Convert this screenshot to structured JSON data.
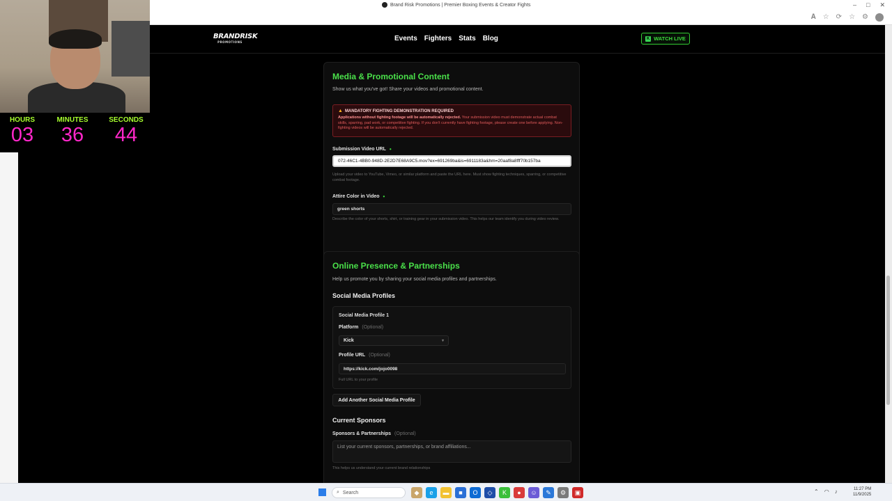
{
  "browser": {
    "tab_title": "Brand Risk Promotions | Premier Boxing Events & Creator Fights",
    "window_controls": [
      "–",
      "□",
      "✕"
    ]
  },
  "site": {
    "logo_text": "BRANDRISK",
    "logo_sub": "PROMOTIONS",
    "nav": [
      "Events",
      "Fighters",
      "Stats",
      "Blog"
    ],
    "watch_live": "WATCH LIVE"
  },
  "media_section": {
    "title": "Media & Promotional Content",
    "subtitle": "Show us what you've got! Share your videos and promotional content.",
    "warning_title": "MANDATORY FIGHTING DEMONSTRATION REQUIRED",
    "warning_bold": "Applications without fighting footage will be automatically rejected.",
    "warning_text": " Your submission video must demonstrate actual combat skills, sparring, pad work, or competitive fighting. If you don't currently have fighting footage, please create one before applying. Non-fighting videos will be automatically rejected.",
    "video_label": "Submission Video URL",
    "video_value": "072-46C1-4BB0-948D-2E2D7E68A9C5.mov?ex=691269ba&is=6911183a&hm=20aaf8a8fff70b157ba",
    "video_hint": "Upload your video to YouTube, Vimeo, or similar platform and paste the URL here. Must show fighting techniques, sparring, or competitive combat footage.",
    "attire_label": "Attire Color in Video",
    "attire_value": "green shorts",
    "attire_hint": "Describe the color of your shorts, shirt, or training gear in your submission video. This helps our team identify you during video review."
  },
  "online_section": {
    "title": "Online Presence & Partnerships",
    "subtitle": "Help us promote you by sharing your social media profiles and partnerships.",
    "social_heading": "Social Media Profiles",
    "profile_title": "Social Media Profile 1",
    "platform_label": "Platform",
    "optional": "(Optional)",
    "platform_value": "Kick",
    "url_label": "Profile URL",
    "url_value": "https://kick.com/jojo0098",
    "url_hint": "Full URL to your profile",
    "add_button": "Add Another Social Media Profile",
    "sponsors_heading": "Current Sponsors",
    "sponsors_label": "Sponsors & Partnerships",
    "sponsors_placeholder": "List your current sponsors, partnerships, or brand affiliations...",
    "sponsors_hint": "This helps us understand your current brand relationships"
  },
  "timer": {
    "hours_label": "HOURS",
    "minutes_label": "MINUTES",
    "seconds_label": "SECONDS",
    "hours": "03",
    "minutes": "36",
    "seconds": "44"
  },
  "taskbar": {
    "search_label": "Search",
    "time": "11:27 PM",
    "date": "11/9/2025"
  },
  "colors": {
    "accent_green": "#4ae04a",
    "warning_red": "#e25b5b",
    "timer_magenta": "#ff27c9",
    "timer_label": "#a7ff2e"
  }
}
